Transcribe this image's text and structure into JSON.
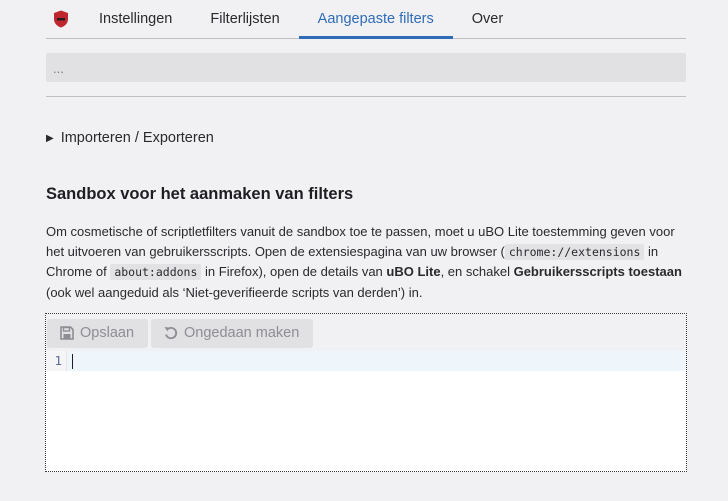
{
  "tabs": [
    {
      "label": "Instellingen",
      "active": false
    },
    {
      "label": "Filterlijsten",
      "active": false
    },
    {
      "label": "Aangepaste filters",
      "active": true
    },
    {
      "label": "Over",
      "active": false
    }
  ],
  "filter_summary": "...",
  "details_label": "Importeren / Exporteren",
  "section_title": "Sandbox voor het aanmaken van filters",
  "description": {
    "part1": "Om cosmetische of scriptletfilters vanuit de sandbox toe te passen, moet u uBO Lite toestemming geven voor het uitvoeren van gebruikersscripts. Open de extensiespagina van uw browser (",
    "code1": "chrome://extensions",
    "part2": " in Chrome of ",
    "code2": "about:addons",
    "part3": " in Firefox), open de details van ",
    "bold1": "uBO Lite",
    "part4": ", en schakel ",
    "bold2": "Gebruikersscripts toestaan",
    "part5": " (ook wel aangeduid als ‘Niet-geverifieerde scripts van derden’) in."
  },
  "editor": {
    "save_label": "Opslaan",
    "undo_label": "Ongedaan maken",
    "line_number": "1"
  },
  "colors": {
    "accent": "#2f6cb8",
    "logo_red": "#c0262d"
  },
  "icons": {
    "logo": "ublock-shield-icon",
    "save": "floppy-disk-icon",
    "undo": "undo-icon"
  }
}
